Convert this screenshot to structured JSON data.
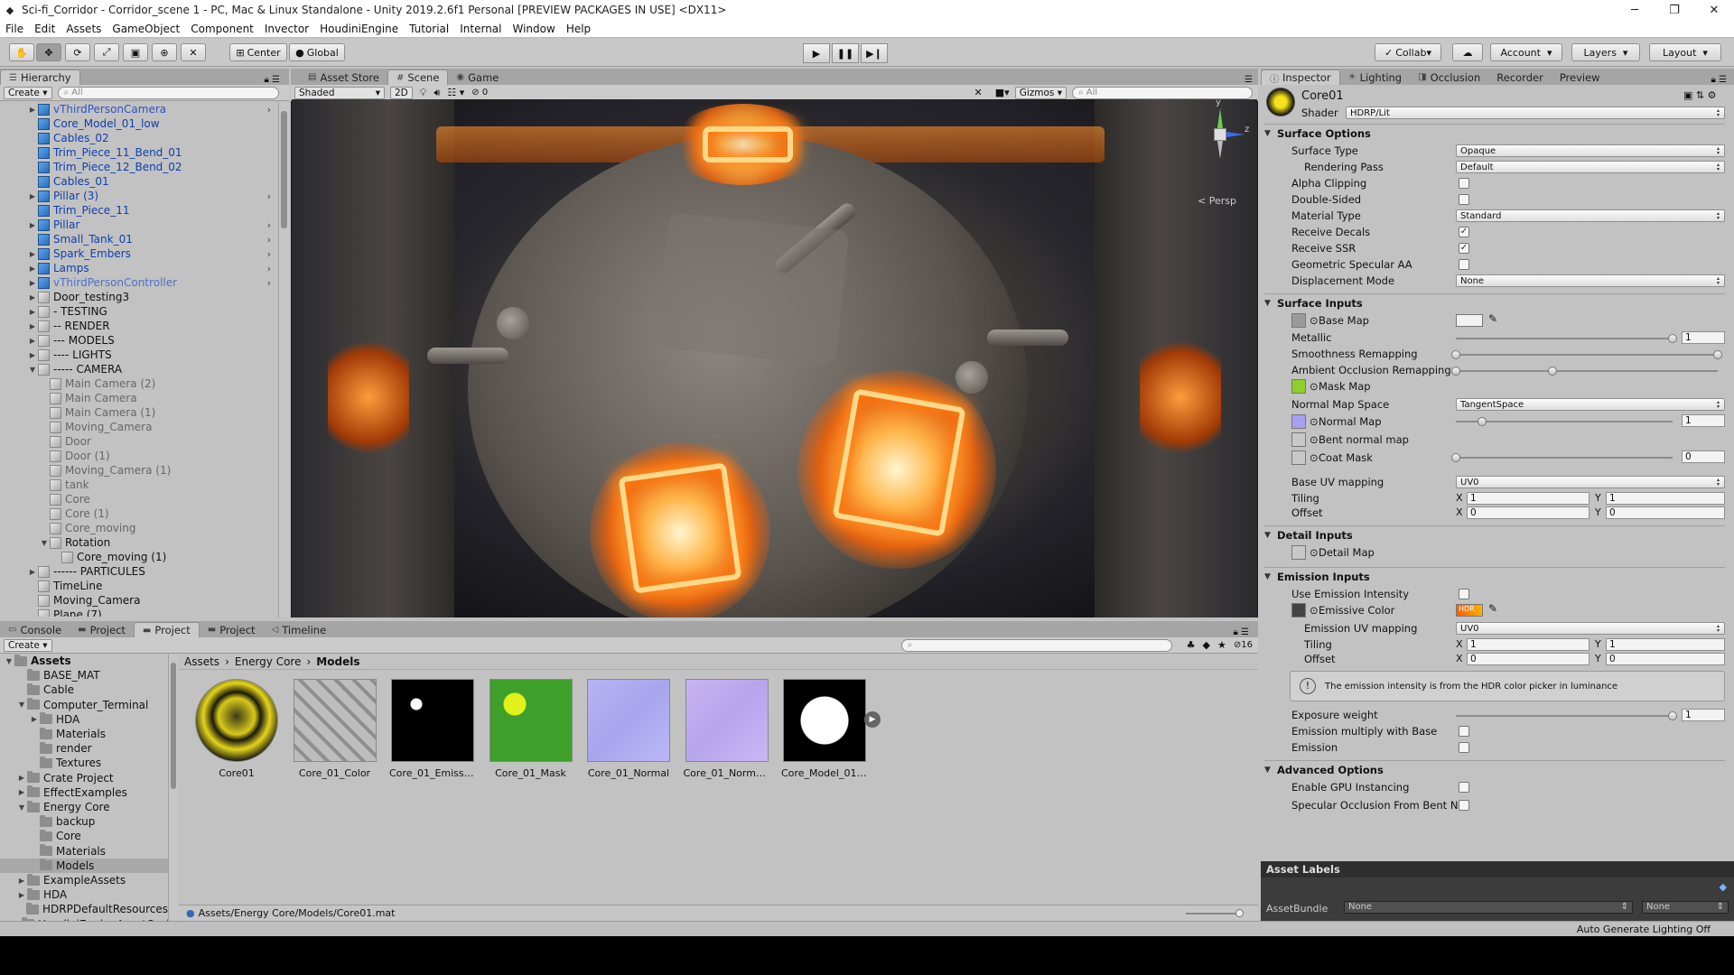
{
  "window": {
    "title": "Sci-fi_Corridor - Corridor_scene 1 - PC, Mac & Linux Standalone - Unity 2019.2.6f1 Personal [PREVIEW PACKAGES IN USE] <DX11>",
    "minimize": "─",
    "maximize": "❐",
    "close": "✕"
  },
  "menu": [
    "File",
    "Edit",
    "Assets",
    "GameObject",
    "Component",
    "Invector",
    "HoudiniEngine",
    "Tutorial",
    "Internal",
    "Window",
    "Help"
  ],
  "toolbar": {
    "center": "Center",
    "global": "Global",
    "collab": "Collab",
    "account": "Account",
    "layers": "Layers",
    "layout": "Layout"
  },
  "hierarchy": {
    "tab": "Hierarchy",
    "create": "Create",
    "search": "All",
    "items": [
      {
        "label": "vThirdPersonCamera",
        "icon": "cube-blue",
        "arrow": true,
        "color": "#2d54c4",
        "chev": true
      },
      {
        "label": "Core_Model_01_low",
        "icon": "cube-blue",
        "arrow": false,
        "color": "#0c3fb0",
        "chev": false
      },
      {
        "label": "Cables_02",
        "icon": "cube-blue",
        "arrow": false,
        "color": "#0c3fb0",
        "chev": false
      },
      {
        "label": "Trim_Piece_11_Bend_01",
        "icon": "cube-blue",
        "arrow": false,
        "color": "#0c3fb0",
        "chev": false
      },
      {
        "label": "Trim_Piece_12_Bend_02",
        "icon": "cube-blue",
        "arrow": false,
        "color": "#0c3fb0",
        "chev": false
      },
      {
        "label": "Cables_01",
        "icon": "cube-blue",
        "arrow": false,
        "color": "#0c3fb0",
        "chev": false
      },
      {
        "label": "Pillar (3)",
        "icon": "cube-blue",
        "arrow": true,
        "color": "#0c3fb0",
        "chev": true
      },
      {
        "label": "Trim_Piece_11",
        "icon": "cube-blue",
        "arrow": false,
        "color": "#0c3fb0",
        "chev": false
      },
      {
        "label": "Pillar",
        "icon": "cube-blue",
        "arrow": true,
        "color": "#0c3fb0",
        "chev": true
      },
      {
        "label": "Small_Tank_01",
        "icon": "cube-blue",
        "arrow": false,
        "color": "#0c3fb0",
        "chev": true
      },
      {
        "label": "Spark_Embers",
        "icon": "cube-blue",
        "arrow": true,
        "color": "#0c3fb0",
        "chev": true
      },
      {
        "label": "Lamps",
        "icon": "cube-blue",
        "arrow": true,
        "color": "#0c3fb0",
        "chev": true
      },
      {
        "label": "vThirdPersonController",
        "icon": "cube-blue",
        "arrow": true,
        "color": "#5070c8",
        "chev": true
      },
      {
        "label": "Door_testing3",
        "icon": "cube-gray",
        "arrow": true,
        "color": "#111",
        "chev": false
      },
      {
        "label": "- TESTING",
        "icon": "cube-gray",
        "arrow": true,
        "color": "#111",
        "chev": false
      },
      {
        "label": "-- RENDER",
        "icon": "cube-gray",
        "arrow": true,
        "color": "#111",
        "chev": false
      },
      {
        "label": "--- MODELS",
        "icon": "cube-gray",
        "arrow": true,
        "color": "#111",
        "chev": false
      },
      {
        "label": "---- LIGHTS",
        "icon": "cube-gray",
        "arrow": true,
        "color": "#111",
        "chev": false
      },
      {
        "label": "----- CAMERA",
        "icon": "cube-gray",
        "arrow": "open",
        "color": "#111",
        "chev": false
      },
      {
        "label": "Main Camera (2)",
        "icon": "cube-gray",
        "indent": 1,
        "color": "#666",
        "chev": false
      },
      {
        "label": "Main Camera",
        "icon": "cube-gray",
        "indent": 1,
        "color": "#666",
        "chev": false
      },
      {
        "label": "Main Camera (1)",
        "icon": "cube-gray",
        "indent": 1,
        "color": "#666",
        "chev": false
      },
      {
        "label": "Moving_Camera",
        "icon": "cube-gray",
        "indent": 1,
        "color": "#666",
        "chev": false
      },
      {
        "label": "Door",
        "icon": "cube-gray",
        "indent": 1,
        "color": "#666",
        "chev": false
      },
      {
        "label": "Door (1)",
        "icon": "cube-gray",
        "indent": 1,
        "color": "#666",
        "chev": false
      },
      {
        "label": "Moving_Camera (1)",
        "icon": "cube-gray",
        "indent": 1,
        "color": "#666",
        "chev": false
      },
      {
        "label": "tank",
        "icon": "cube-gray",
        "indent": 1,
        "color": "#666",
        "chev": false
      },
      {
        "label": "Core",
        "icon": "cube-gray",
        "indent": 1,
        "color": "#666",
        "chev": false
      },
      {
        "label": "Core (1)",
        "icon": "cube-gray",
        "indent": 1,
        "color": "#666",
        "chev": false
      },
      {
        "label": "Core_moving",
        "icon": "cube-gray",
        "indent": 1,
        "color": "#666",
        "chev": false
      },
      {
        "label": "Rotation",
        "icon": "cube-gray",
        "indent": 1,
        "arrow": "open",
        "color": "#111",
        "chev": false
      },
      {
        "label": "Core_moving (1)",
        "icon": "cube-gray",
        "indent": 2,
        "color": "#111",
        "chev": false
      },
      {
        "label": "------ PARTICULES",
        "icon": "cube-gray",
        "arrow": true,
        "color": "#111",
        "chev": false
      },
      {
        "label": "TimeLine",
        "icon": "cube-gray",
        "arrow": false,
        "color": "#111",
        "chev": false
      },
      {
        "label": "Moving_Camera",
        "icon": "cube-gray",
        "arrow": false,
        "color": "#111",
        "chev": false
      },
      {
        "label": "Plane (7)",
        "icon": "cube-gray",
        "arrow": false,
        "color": "#111",
        "chev": false
      }
    ]
  },
  "scene": {
    "tabs": [
      "Asset Store",
      "Scene",
      "Game"
    ],
    "shading": "Shaded",
    "mode2d": "2D",
    "effects_count": "0",
    "gizmos": "Gizmos",
    "search": "All",
    "persp": "< Persp",
    "axes": {
      "y": "y",
      "z": "z"
    }
  },
  "bottom": {
    "tabs": [
      "Console",
      "Project",
      "Project",
      "Project",
      "Timeline"
    ],
    "create": "Create",
    "layers_count": "16",
    "breadcrumb": [
      "Assets",
      "Energy Core",
      "Models"
    ],
    "folders": [
      {
        "label": "Assets",
        "indent": 0,
        "open": true,
        "bold": true
      },
      {
        "label": "BASE_MAT",
        "indent": 1
      },
      {
        "label": "Cable",
        "indent": 1
      },
      {
        "label": "Computer_Terminal",
        "indent": 1,
        "open": true,
        "arrow": true
      },
      {
        "label": "HDA",
        "indent": 2,
        "arrow": true
      },
      {
        "label": "Materials",
        "indent": 2
      },
      {
        "label": "render",
        "indent": 2
      },
      {
        "label": "Textures",
        "indent": 2
      },
      {
        "label": "Crate Project",
        "indent": 1,
        "arrow": true
      },
      {
        "label": "EffectExamples",
        "indent": 1,
        "arrow": true
      },
      {
        "label": "Energy Core",
        "indent": 1,
        "open": true,
        "arrow": true
      },
      {
        "label": "backup",
        "indent": 2
      },
      {
        "label": "Core",
        "indent": 2
      },
      {
        "label": "Materials",
        "indent": 2
      },
      {
        "label": "Models",
        "indent": 2,
        "selected": true
      },
      {
        "label": "ExampleAssets",
        "indent": 1,
        "arrow": true
      },
      {
        "label": "HDA",
        "indent": 1,
        "arrow": true
      },
      {
        "label": "HDRPDefaultResources",
        "indent": 1
      },
      {
        "label": "HoudiniEngineAssetCache",
        "indent": 1,
        "arrow": true
      }
    ],
    "assets": [
      {
        "label": "Core01",
        "kind": "material"
      },
      {
        "label": "Core_01_Color",
        "kind": "color"
      },
      {
        "label": "Core_01_Emissive",
        "kind": "emissive"
      },
      {
        "label": "Core_01_Mask",
        "kind": "mask"
      },
      {
        "label": "Core_01_Normal",
        "kind": "normal"
      },
      {
        "label": "Core_01_Normal ...",
        "kind": "normal2"
      },
      {
        "label": "Core_Model_01_l...",
        "kind": "model"
      }
    ],
    "status_path": "Assets/Energy Core/Models/Core01.mat"
  },
  "inspector": {
    "tabs": [
      "Inspector",
      "Lighting",
      "Occlusion",
      "Recorder",
      "Preview"
    ],
    "name": "Core01",
    "shader_label": "Shader",
    "shader": "HDRP/Lit",
    "surface_options": "Surface Options",
    "surface_type": {
      "label": "Surface Type",
      "value": "Opaque"
    },
    "rendering_pass": {
      "label": "Rendering Pass",
      "value": "Default"
    },
    "alpha_clipping": {
      "label": "Alpha Clipping",
      "checked": false
    },
    "double_sided": {
      "label": "Double-Sided",
      "checked": false
    },
    "material_type": {
      "label": "Material Type",
      "value": "Standard"
    },
    "receive_decals": {
      "label": "Receive Decals",
      "checked": true
    },
    "receive_ssr": {
      "label": "Receive SSR",
      "checked": true
    },
    "geo_aa": {
      "label": "Geometric Specular AA",
      "checked": false
    },
    "displacement": {
      "label": "Displacement Mode",
      "value": "None"
    },
    "surface_inputs": "Surface Inputs",
    "base_map": "Base Map",
    "metallic": {
      "label": "Metallic",
      "value": "1",
      "level": 1
    },
    "smoothness": "Smoothness Remapping",
    "ao": "Ambient Occlusion Remapping",
    "mask_map": "Mask Map",
    "normal_space": {
      "label": "Normal Map Space",
      "value": "TangentSpace"
    },
    "normal_map": {
      "label": "Normal Map",
      "value": "1",
      "level": 0.12
    },
    "bent": "Bent normal map",
    "coat": {
      "label": "Coat Mask",
      "value": "0",
      "level": 0
    },
    "base_uv": {
      "label": "Base UV mapping",
      "value": "UV0"
    },
    "tiling": {
      "label": "Tiling",
      "x": "1",
      "y": "1"
    },
    "offset": {
      "label": "Offset",
      "x": "0",
      "y": "0"
    },
    "detail_inputs": "Detail Inputs",
    "detail_map": "Detail Map",
    "emission_inputs": "Emission Inputs",
    "use_emission": {
      "label": "Use Emission Intensity",
      "checked": false
    },
    "emissive_color": "Emissive Color",
    "hdr": "HDR",
    "emission_uv": {
      "label": "Emission UV mapping",
      "value": "UV0"
    },
    "e_tiling": {
      "label": "Tiling",
      "x": "1",
      "y": "1"
    },
    "e_offset": {
      "label": "Offset",
      "x": "0",
      "y": "0"
    },
    "info": "The emission intensity is from the HDR color picker in luminance",
    "exposure": {
      "label": "Exposure weight",
      "value": "1",
      "level": 1
    },
    "emission_mult": {
      "label": "Emission multiply with Base",
      "checked": false
    },
    "emission": {
      "label": "Emission",
      "checked": false
    },
    "advanced": "Advanced Options",
    "gpu_instancing": {
      "label": "Enable GPU Instancing",
      "checked": false
    },
    "spec_occ": {
      "label": "Specular Occlusion From Bent N",
      "checked": false
    },
    "asset_labels": "Asset Labels",
    "asset_bundle": "AssetBundle",
    "bundle1": "None",
    "bundle2": "None"
  },
  "statusbar": {
    "right": "Auto Generate Lighting Off"
  },
  "axis_x": "X",
  "axis_y": "Y"
}
